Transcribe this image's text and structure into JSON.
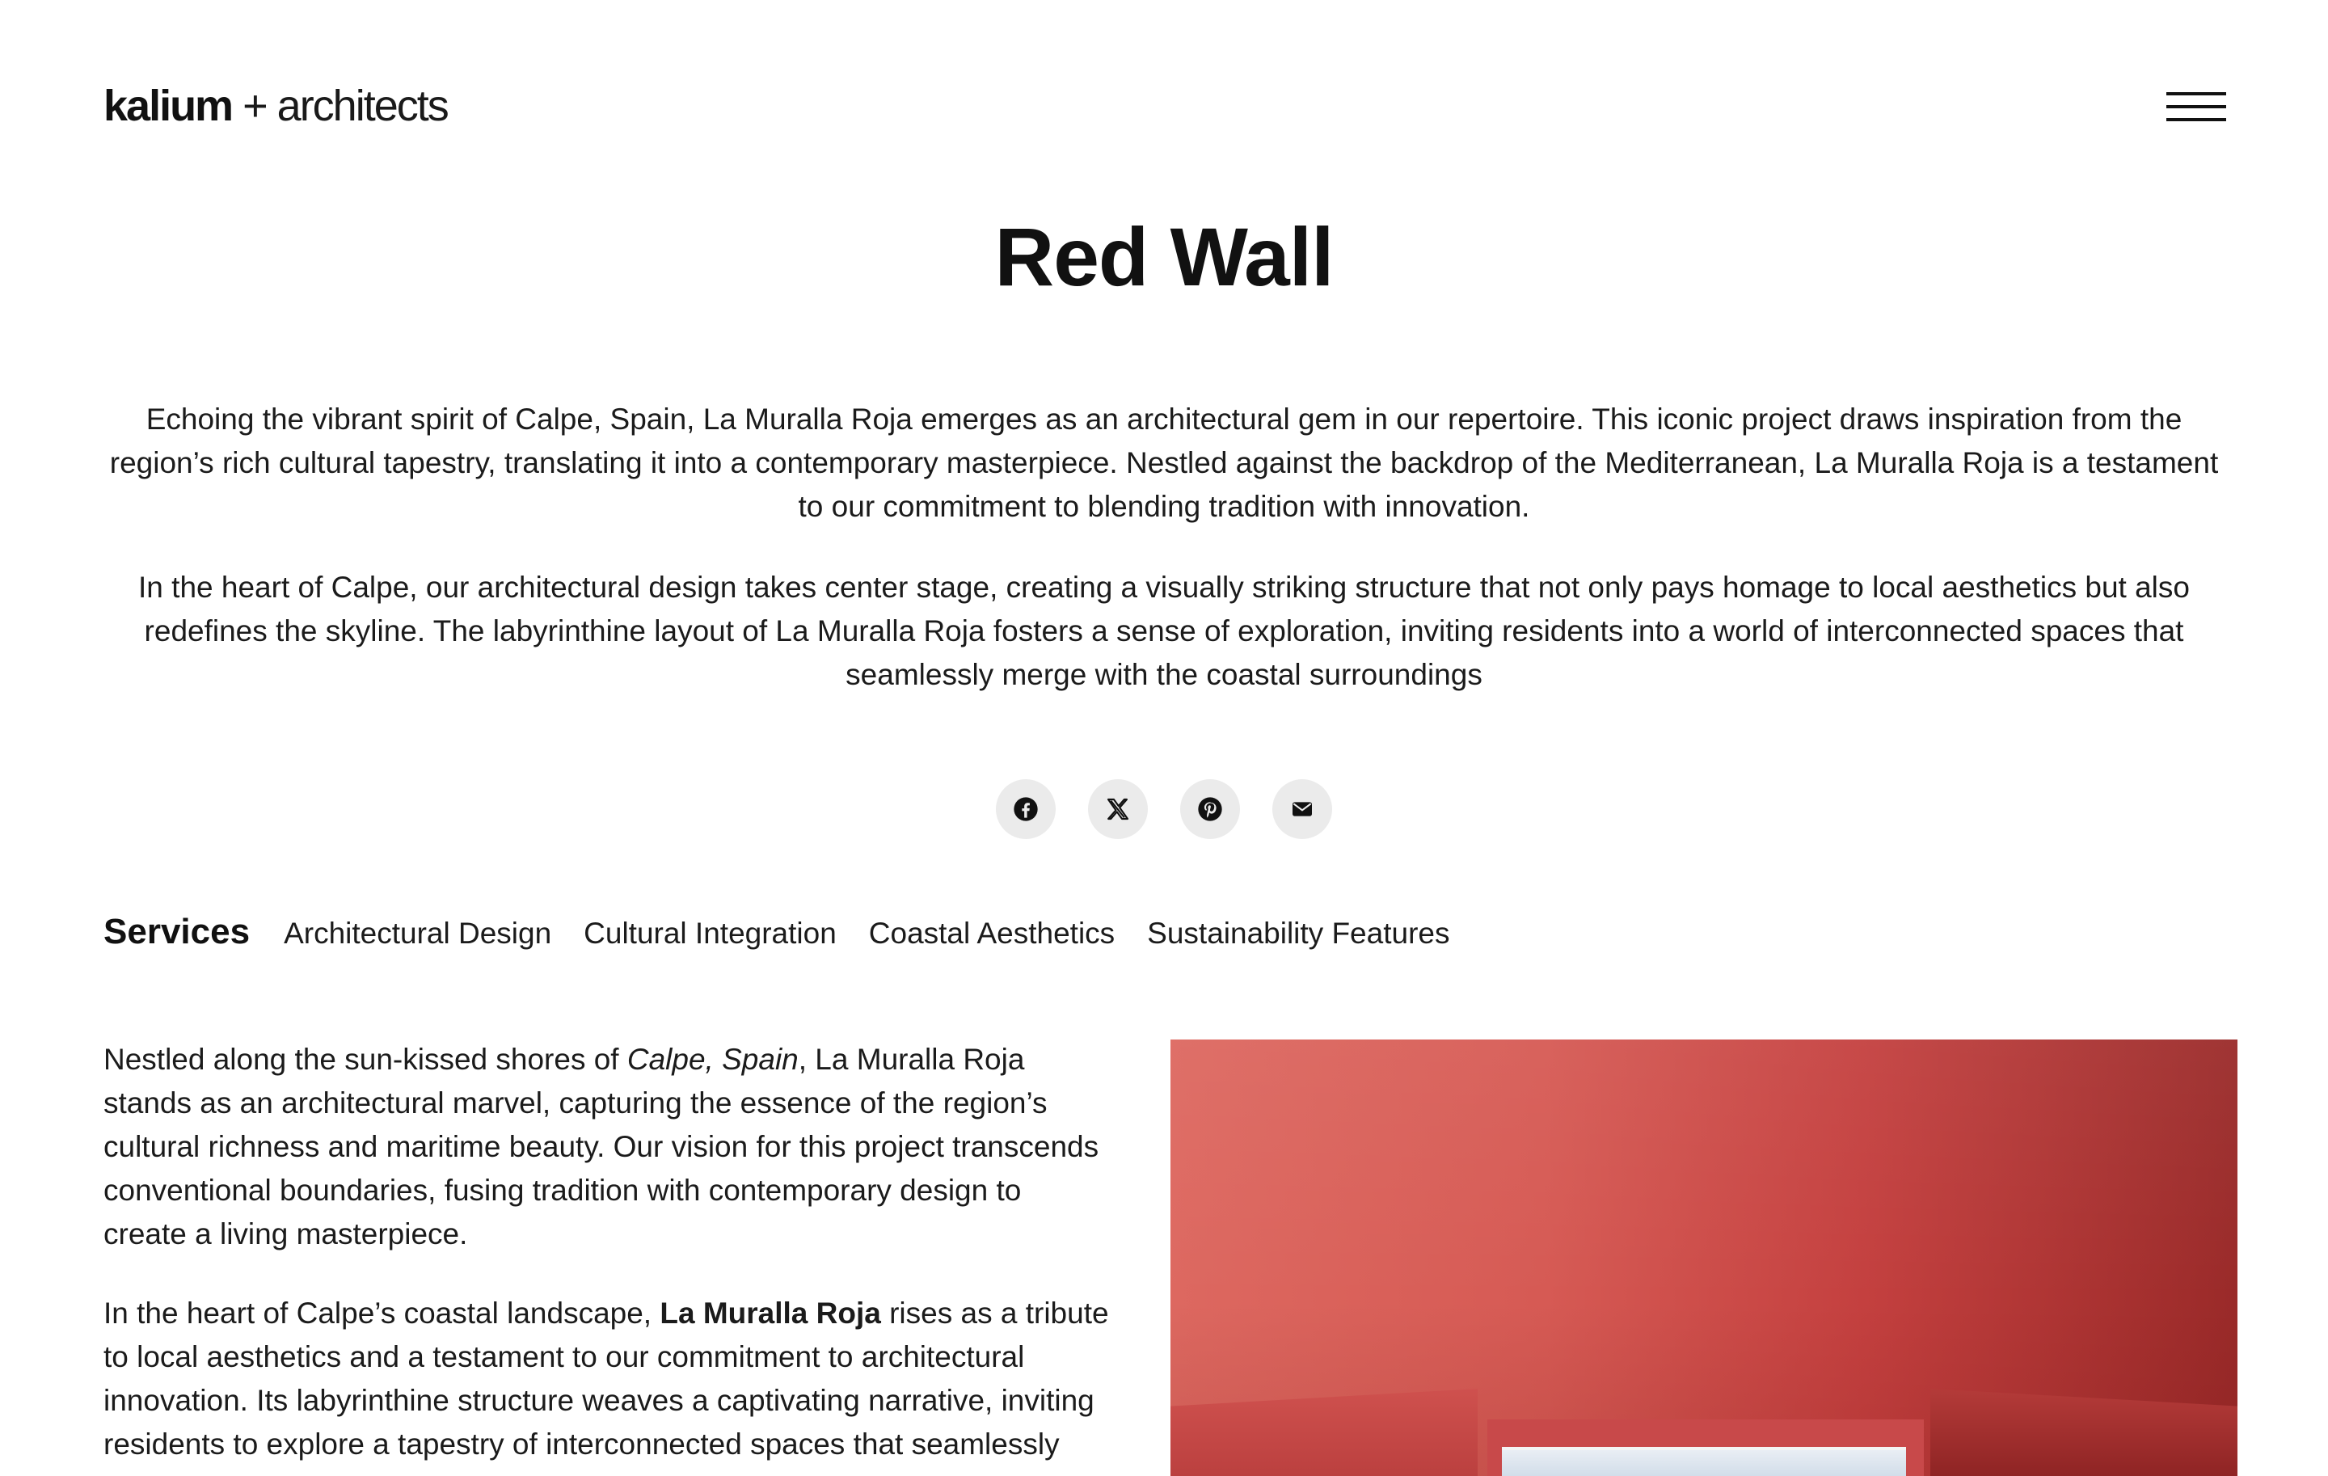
{
  "header": {
    "logo_brand": "kalium",
    "logo_plus": "+",
    "logo_rest": "architects"
  },
  "project": {
    "title": "Red Wall",
    "intro": [
      "Echoing the vibrant spirit of Calpe, Spain, La Muralla Roja emerges as an architectural gem in our repertoire. This iconic project draws inspiration from the region’s rich cultural tapestry, translating it into a contemporary masterpiece. Nestled against the backdrop of the Mediterranean, La Muralla Roja is a testament to our commitment to blending tradition with innovation.",
      "In the heart of Calpe, our architectural design takes center stage, creating a visually striking structure that not only pays homage to local aesthetics but also redefines the skyline. The labyrinthine layout of La Muralla Roja fosters a sense of exploration, inviting residents into a world of interconnected spaces that seamlessly merge with the coastal surroundings"
    ]
  },
  "share": {
    "icons": [
      "facebook-icon",
      "x-icon",
      "pinterest-icon",
      "email-icon"
    ]
  },
  "services": {
    "label": "Services",
    "items": [
      "Architectural Design",
      "Cultural Integration",
      "Coastal Aesthetics",
      "Sustainability Features"
    ]
  },
  "body": {
    "p1_before": "Nestled along the sun-kissed shores of ",
    "p1_emphasis": "Calpe, Spain",
    "p1_after": ", La Muralla Roja stands as an architectural marvel, capturing the essence of the region’s cultural richness and maritime beauty. Our vision for this project transcends conventional boundaries, fusing tradition with contemporary design to create a living masterpiece.",
    "p2_before": "In the heart of Calpe’s coastal landscape, ",
    "p2_strong": "La Muralla Roja",
    "p2_after": " rises as a tribute to local aesthetics and a testament to our commitment to architectural innovation. Its labyrinthine structure weaves a captivating narrative, inviting residents to explore a tapestry of interconnected spaces that seamlessly integrate with the coastal beauty of the Mediterranean."
  },
  "colors": {
    "text": "#111111",
    "social_button_bg": "#ebebeb",
    "photo_red": "#d65a54"
  }
}
